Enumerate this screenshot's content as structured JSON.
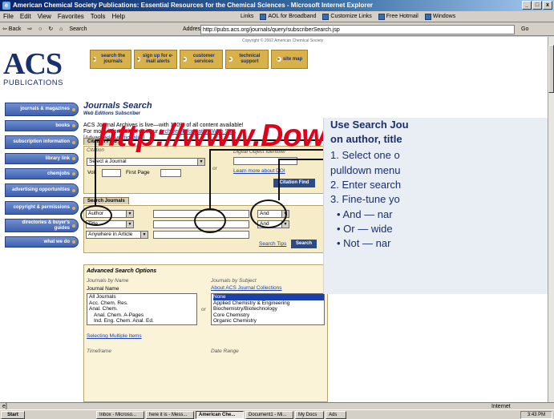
{
  "window": {
    "title": "American Chemical Society Publications: Essential Resources for the Chemical Sciences - Microsoft Internet Explorer",
    "controls": [
      "_",
      "□",
      "x"
    ]
  },
  "menu": [
    "File",
    "Edit",
    "View",
    "Favorites",
    "Tools",
    "Help"
  ],
  "links_bar": {
    "label": "Links",
    "items": [
      "AOL for Broadband",
      "Customize Links",
      "Free Hotmail",
      "Windows"
    ]
  },
  "toolbar": {
    "back": "⇦ Back",
    "forward": "⇨",
    "search": "Search",
    "address_label": "Address",
    "address": "http://pubs.acs.org/journals/query/subscriberSearch.jsp",
    "go": "Go"
  },
  "page": {
    "logo_main": "ACS",
    "logo_sub": "PUBLICATIONS",
    "copyright": "Copyright © 2002 American Chemical Society",
    "top_nav": [
      {
        "label": "search the journals"
      },
      {
        "label": "sign up for e-mail alerts"
      },
      {
        "label": "customer services"
      },
      {
        "label": "technical support"
      },
      {
        "label": "site map"
      }
    ],
    "side_nav": [
      {
        "label": "journals & magazines"
      },
      {
        "label": "books"
      },
      {
        "label": "subscription information"
      },
      {
        "label": "library link"
      },
      {
        "label": "chemjobs"
      },
      {
        "label": "advertising opportunities"
      },
      {
        "label": "copyright & permissions"
      },
      {
        "label": "directories & buyer's guides"
      },
      {
        "label": "what we do"
      }
    ],
    "heading": "Journals Search",
    "subheading": "Web Editions Subscriber",
    "intro_line1": "ACS Journal Archives is live—with 100% of all content available!",
    "intro_line2a": "For more information, visit our ",
    "intro_link": "Archives Information Web Site",
    "intro_line2b": ".",
    "advanced_link": "[Advanced Functionality]",
    "citation": {
      "tab": "Citation Find",
      "citation_label": "Citation",
      "journal_select": "Select a Journal",
      "vol_label": "Vol",
      "first_page_label": "First Page",
      "or_label": "or",
      "doi_label": "Digital Object Identifier",
      "doi_link": "Learn more about DOI",
      "button": "Citation Find"
    },
    "search": {
      "tab": "Search Journals",
      "row1_field": "Author",
      "row2_field": "Title",
      "row3_field": "Anywhere in Article",
      "op1": "And",
      "op2": "And",
      "tips_link": "Search Tips",
      "button": "Search"
    },
    "advanced": {
      "heading": "Advanced Search Options",
      "by_name_label": "Journals by Name",
      "journal_name_label": "Journal Name",
      "journals": [
        "All Journals",
        "Acc. Chem. Res.",
        "Anal. Chem.",
        "Anal. Chem. A-Pages",
        "Ind. Eng. Chem. Anal. Ed."
      ],
      "or_label": "or",
      "by_subject_label": "Journals by Subject",
      "collections_link": "About ACS Journal Collections",
      "subjects": [
        "None",
        "Applied Chemistry & Engineering",
        "Biochemistry/Biotechnology",
        "Core Chemistry",
        "Organic Chemistry"
      ],
      "multiple_link": "Selecting Multiple Items",
      "timeframe_label": "Timeframe",
      "date_range_label": "Date Range"
    }
  },
  "watermark": "http://www.Download",
  "callout": {
    "title_line1": "Use Search Jou",
    "title_line2": "on author, title",
    "step1a": "1. Select one o",
    "step1b": "pulldown menu",
    "step2": "2. Enter search",
    "step3": "3. Fine-tune yo",
    "bullets": [
      "• And — nar",
      "• Or — wide",
      "• Not — nar"
    ]
  },
  "status": {
    "left": "e]",
    "zone": "Internet"
  },
  "taskbar": {
    "start": "Start",
    "buttons": [
      "Inbox - Microso...",
      "here it is - Mess...",
      "American Che...",
      "Document1 - Mi...",
      "My Docs",
      "Ads"
    ],
    "clock": "3:43 PM"
  }
}
